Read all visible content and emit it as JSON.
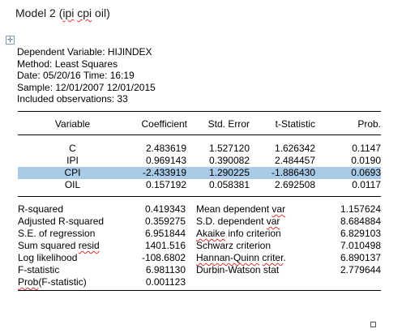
{
  "title": "Model 2 (ipi cpi oil)",
  "meta": {
    "dependent": "Dependent Variable: HIJINDEX",
    "method": "Method: Least Squares",
    "date": "Date: 05/20/16   Time: 16:19",
    "sample": "Sample: 12/01/2007 12/01/2015",
    "observations": "Included observations: 33"
  },
  "columns": [
    "Variable",
    "Coefficient",
    "Std. Error",
    "t-Statistic",
    "Prob."
  ],
  "coefficients": [
    {
      "variable": "C",
      "coefficient": "2.483619",
      "std_error": "1.527120",
      "t_stat": "1.626342",
      "prob": "0.1147"
    },
    {
      "variable": "IPI",
      "coefficient": "0.969143",
      "std_error": "0.390082",
      "t_stat": "2.484457",
      "prob": "0.0190"
    },
    {
      "variable": "CPI",
      "coefficient": "-2.433919",
      "std_error": "1.290225",
      "t_stat": "-1.886430",
      "prob": "0.0693"
    },
    {
      "variable": "OIL",
      "coefficient": "0.157192",
      "std_error": "0.058381",
      "t_stat": "2.692508",
      "prob": "0.0117"
    }
  ],
  "stats": [
    {
      "label": "R-squared",
      "value": "0.419343",
      "label2": "Mean dependent var",
      "value2": "1.157624"
    },
    {
      "label": "Adjusted R-squared",
      "value": "0.359275",
      "label2": "S.D. dependent var",
      "value2": "8.684884"
    },
    {
      "label": "S.E. of regression",
      "value": "6.951844",
      "label2": "Akaike info criterion",
      "value2": "6.829103"
    },
    {
      "label": "Sum squared resid",
      "value": "1401.516",
      "label2": "Schwarz criterion",
      "value2": "7.010498"
    },
    {
      "label": "Log likelihood",
      "value": "-108.6802",
      "label2": "Hannan-Quinn criter.",
      "value2": "6.890137"
    },
    {
      "label": "F-statistic",
      "value": "6.981130",
      "label2": "Durbin-Watson stat",
      "value2": "2.779644"
    },
    {
      "label": "Prob(F-statistic)",
      "value": "0.001123",
      "label2": "",
      "value2": ""
    }
  ],
  "icons": {
    "anchor": "move-anchor-icon",
    "handle": "resize-handle-icon"
  },
  "colors": {
    "highlight": "#a9cbe8",
    "spellcheck": "#e03030"
  }
}
